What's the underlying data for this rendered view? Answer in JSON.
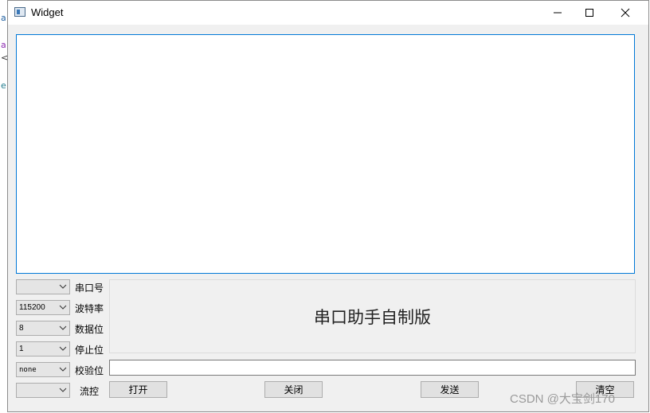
{
  "background_editor": {
    "chars": [
      "a",
      "a",
      "<",
      "e"
    ]
  },
  "window": {
    "title": "Widget",
    "controls": {
      "minimize": "—",
      "maximize": "☐",
      "close": "✕"
    }
  },
  "settings": [
    {
      "value": "",
      "label": "串口号"
    },
    {
      "value": "115200",
      "label": "波特率"
    },
    {
      "value": "8",
      "label": "数据位"
    },
    {
      "value": "1",
      "label": "停止位"
    },
    {
      "value": "none",
      "label": "校验位"
    },
    {
      "value": "",
      "label": "流控"
    }
  ],
  "banner": "串口助手自制版",
  "send_input": {
    "value": ""
  },
  "buttons": {
    "open": "打开",
    "close": "关闭",
    "send": "发送",
    "clear": "清空"
  },
  "watermark": "CSDN @大宝剑170"
}
